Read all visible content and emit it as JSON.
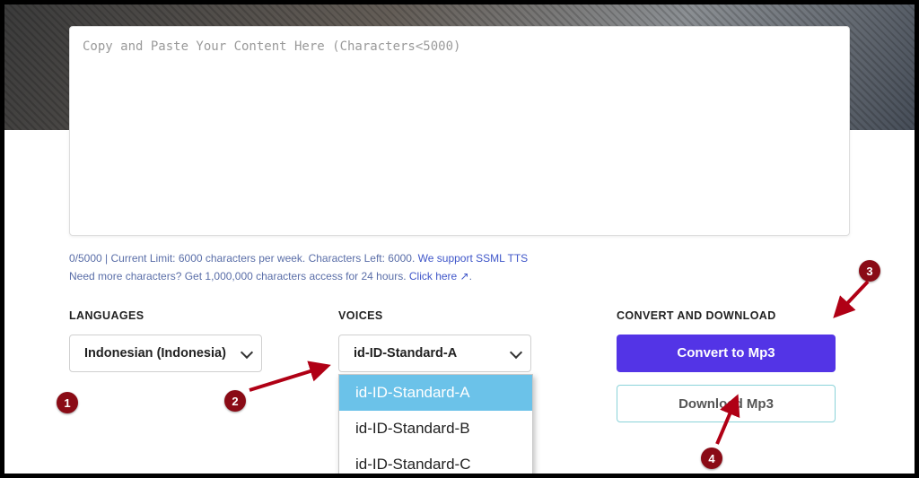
{
  "textarea": {
    "placeholder": "Copy and Paste Your Content Here (Characters<5000)",
    "value": ""
  },
  "meta": {
    "counter": "0/5000",
    "limit_text": " | Current Limit: 6000 characters per week. Characters Left: 6000. ",
    "ssml_link": "We support SSML TTS",
    "need_more": "Need more characters? Get 1,000,000 characters access for 24 hours. ",
    "click_here": "Click here ↗",
    "period": "."
  },
  "sections": {
    "languages_label": "LANGUAGES",
    "voices_label": "VOICES",
    "convert_label": "CONVERT AND DOWNLOAD"
  },
  "languages": {
    "selected": "Indonesian (Indonesia)"
  },
  "voices": {
    "selected": "id-ID-Standard-A",
    "options": [
      "id-ID-Standard-A",
      "id-ID-Standard-B",
      "id-ID-Standard-C"
    ]
  },
  "buttons": {
    "convert": "Convert to Mp3",
    "download": "Download Mp3"
  },
  "annotations": {
    "n1": "1",
    "n2": "2",
    "n3": "3",
    "n4": "4"
  }
}
